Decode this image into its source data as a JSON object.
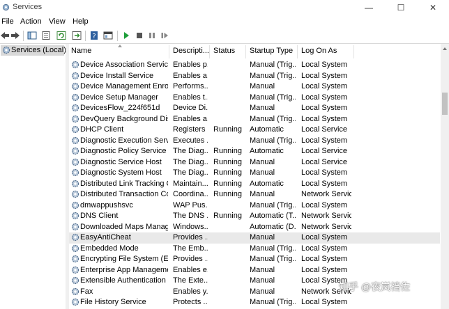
{
  "window": {
    "title": "Services",
    "minimize": "—",
    "maximize": "☐",
    "close": "✕"
  },
  "menu": [
    "File",
    "Action",
    "View",
    "Help"
  ],
  "tree": {
    "label": "Services (Local)"
  },
  "columns": [
    "Name",
    "Descripti...",
    "Status",
    "Startup Type",
    "Log On As"
  ],
  "rows": [
    [
      "Device Association Service",
      "Enables p...",
      "",
      "Manual (Trig...",
      "Local System"
    ],
    [
      "Device Install Service",
      "Enables a...",
      "",
      "Manual (Trig...",
      "Local System"
    ],
    [
      "Device Management Enroll...",
      "Performs...",
      "",
      "Manual",
      "Local System"
    ],
    [
      "Device Setup Manager",
      "Enables t...",
      "",
      "Manual (Trig...",
      "Local System"
    ],
    [
      "DevicesFlow_224f651d",
      "Device Di...",
      "",
      "Manual",
      "Local System"
    ],
    [
      "DevQuery Background Disc...",
      "Enables a...",
      "",
      "Manual (Trig...",
      "Local System"
    ],
    [
      "DHCP Client",
      "Registers ...",
      "Running",
      "Automatic",
      "Local Service"
    ],
    [
      "Diagnostic Execution Service",
      "Executes ...",
      "",
      "Manual (Trig...",
      "Local System"
    ],
    [
      "Diagnostic Policy Service",
      "The Diag...",
      "Running",
      "Automatic",
      "Local Service"
    ],
    [
      "Diagnostic Service Host",
      "The Diag...",
      "Running",
      "Manual",
      "Local Service"
    ],
    [
      "Diagnostic System Host",
      "The Diag...",
      "Running",
      "Manual",
      "Local System"
    ],
    [
      "Distributed Link Tracking Cl...",
      "Maintain...",
      "Running",
      "Automatic",
      "Local System"
    ],
    [
      "Distributed Transaction Coo...",
      "Coordina...",
      "Running",
      "Manual",
      "Network Service"
    ],
    [
      "dmwappushsvc",
      "WAP Pus...",
      "",
      "Manual (Trig...",
      "Local System"
    ],
    [
      "DNS Client",
      "The DNS ...",
      "Running",
      "Automatic (T...",
      "Network Service"
    ],
    [
      "Downloaded Maps Manager",
      "Windows...",
      "",
      "Automatic (D...",
      "Network Service"
    ],
    [
      "EasyAntiCheat",
      "Provides ...",
      "",
      "Manual",
      "Local System"
    ],
    [
      "Embedded Mode",
      "The Emb...",
      "",
      "Manual (Trig...",
      "Local System"
    ],
    [
      "Encrypting File System (EFS)",
      "Provides ...",
      "",
      "Manual (Trig...",
      "Local System"
    ],
    [
      "Enterprise App Managemen...",
      "Enables e...",
      "",
      "Manual",
      "Local System"
    ],
    [
      "Extensible Authentication P...",
      "The Exte...",
      "",
      "Manual",
      "Local System"
    ],
    [
      "Fax",
      "Enables y...",
      "",
      "Manual",
      "Network Service"
    ],
    [
      "File History Service",
      "Protects ...",
      "",
      "Manual (Trig...",
      "Local System"
    ]
  ],
  "selected_row": 16,
  "watermark": "知乎 @夜岚裆佐",
  "colors": {
    "selected_row": "#e9e9e9",
    "tree_selected": "#d9d9d9",
    "play": "#1e9e3a"
  }
}
